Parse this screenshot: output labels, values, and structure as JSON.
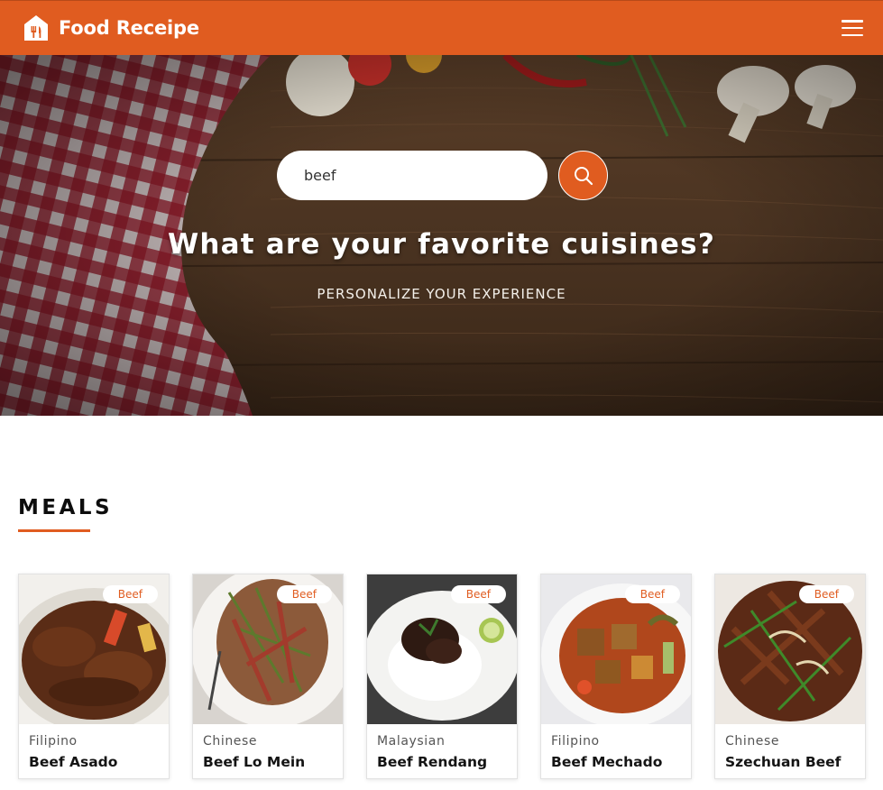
{
  "header": {
    "brand": "Food Receipe",
    "logo_icon": "house-fork-knife-icon",
    "menu_icon": "hamburger-menu-icon",
    "brand_color": "#e05c20"
  },
  "hero": {
    "search_value": "beef",
    "search_icon": "magnifier-icon",
    "title": "What are your favorite cuisines?",
    "subtitle": "PERSONALIZE YOUR EXPERIENCE"
  },
  "meals": {
    "heading": "MEALS",
    "items": [
      {
        "tag": "Beef",
        "area": "Filipino",
        "name": "Beef Asado"
      },
      {
        "tag": "Beef",
        "area": "Chinese",
        "name": "Beef Lo Mein"
      },
      {
        "tag": "Beef",
        "area": "Malaysian",
        "name": "Beef Rendang"
      },
      {
        "tag": "Beef",
        "area": "Filipino",
        "name": "Beef Mechado"
      },
      {
        "tag": "Beef",
        "area": "Chinese",
        "name": "Szechuan Beef"
      }
    ]
  }
}
